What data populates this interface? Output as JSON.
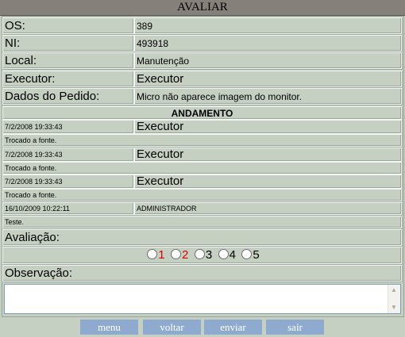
{
  "window": {
    "title": "AVALIAR"
  },
  "form": {
    "os_label": "OS:",
    "os_value": "389",
    "ni_label": "NI:",
    "ni_value": "493918",
    "local_label": "Local:",
    "local_value": "Manutenção",
    "executor_label": "Executor:",
    "executor_value": "Executor",
    "dados_label": "Dados do Pedido:",
    "dados_value": "Micro não aparece imagem do monitor."
  },
  "andamento": {
    "header": "ANDAMENTO",
    "entries": [
      {
        "datetime": "7/2/2008 19:33:43",
        "executor": "Executor",
        "note": "Trocado a fonte."
      },
      {
        "datetime": "7/2/2008 19:33:43",
        "executor": "Executor",
        "note": "Trocado a fonte."
      },
      {
        "datetime": "7/2/2008 19:33:43",
        "executor": "Executor",
        "note": "Trocado a fonte."
      },
      {
        "datetime": "16/10/2009 10:22:11",
        "executor": "ADMINISTRADOR",
        "note": "Teste."
      }
    ]
  },
  "avaliacao": {
    "label": "Avaliação:",
    "options": [
      "1",
      "2",
      "3",
      "4",
      "5"
    ],
    "option_colors": [
      "#e00000",
      "#e00000",
      "#000000",
      "#000000",
      "#000000"
    ]
  },
  "observacao": {
    "label": "Observação:",
    "value": ""
  },
  "buttons": {
    "menu": "menu",
    "voltar": "voltar",
    "enviar": "enviar",
    "sair": "sair"
  }
}
